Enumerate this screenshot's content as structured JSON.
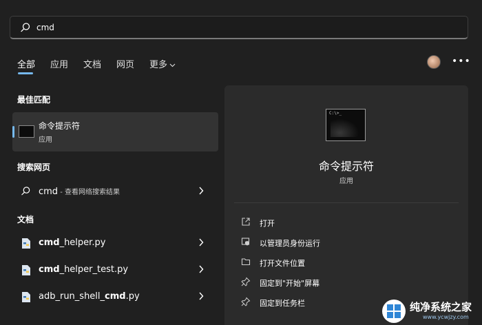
{
  "search": {
    "query": "cmd"
  },
  "tabs": [
    {
      "label": "全部"
    },
    {
      "label": "应用"
    },
    {
      "label": "文档"
    },
    {
      "label": "网页"
    },
    {
      "label": "更多"
    }
  ],
  "header": {
    "more_options": "•••"
  },
  "best_match": {
    "section": "最佳匹配",
    "name": "命令提示符",
    "type": "应用"
  },
  "web": {
    "section": "搜索网页",
    "query": "cmd",
    "hint": " - 查看网络搜索结果"
  },
  "documents": {
    "section": "文档",
    "items": [
      {
        "bold": "cmd",
        "rest": "_helper.py",
        "prefix": ""
      },
      {
        "bold": "cmd",
        "rest": "_helper_test.py",
        "prefix": ""
      },
      {
        "prefix": "adb_run_shell_",
        "bold": "cmd",
        "rest": ".py"
      }
    ]
  },
  "preview": {
    "prompt": "C:\\>_",
    "title": "命令提示符",
    "subtitle": "应用",
    "actions": [
      {
        "label": "打开",
        "icon": "open-icon"
      },
      {
        "label": "以管理员身份运行",
        "icon": "admin-shield-icon"
      },
      {
        "label": "打开文件位置",
        "icon": "folder-icon"
      },
      {
        "label": "固定到\"开始\"屏幕",
        "icon": "pin-icon"
      },
      {
        "label": "固定到任务栏",
        "icon": "pin-icon"
      }
    ]
  },
  "watermark": {
    "title": "纯净系统之家",
    "url": "www.ycwjzy.com"
  },
  "colors": {
    "accent": "#76b9ed",
    "background": "#202020",
    "panel": "#2b2b2b",
    "selected": "#333333"
  }
}
